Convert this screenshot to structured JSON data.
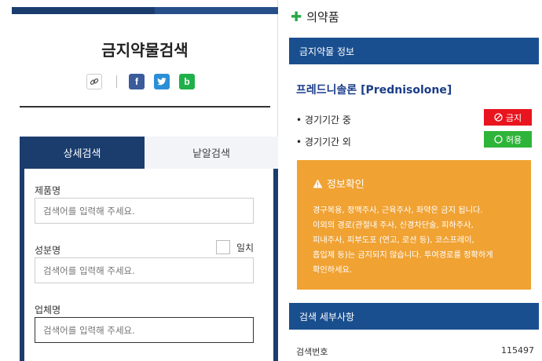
{
  "left": {
    "title": "금지약물검색",
    "tabs": [
      "상세검색",
      "낱알검색"
    ],
    "fields": [
      {
        "label": "제품명",
        "placeholder": "검색어를 입력해 주세요."
      },
      {
        "label": "성분명",
        "placeholder": "검색어를 입력해 주세요."
      },
      {
        "label": "업체명",
        "placeholder": "검색어를 입력해 주세요."
      }
    ],
    "exact_match_label": "일치",
    "share": {
      "facebook": "f",
      "blog": "b"
    }
  },
  "right": {
    "header": "의약품",
    "info_bar": "금지약물 정보",
    "drug_name": "프레드니솔론 [Prednisolone]",
    "in_competition": {
      "label": "경기기간 중",
      "status": "금지",
      "color": "#e8141e"
    },
    "out_competition": {
      "label": "경기기간 외",
      "status": "허용",
      "color": "#2fb43a"
    },
    "notice": {
      "title": "정보확인",
      "lines": [
        "경구복용, 정맥주사, 근육주사, 좌약은 금지 됩니다.",
        "이외의 경로(관절내 주사, 신경차단술, 피하주사,",
        "피내주사, 피부도포 (연고, 로션 등), 코스프레이,",
        "흡입제 등)는 금지되지 않습니다. 투여경로를 정확하게",
        "확인하세요."
      ]
    },
    "detail_bar": "검색 세부사항",
    "detail": {
      "label": "검색번호",
      "value": "115497"
    }
  }
}
